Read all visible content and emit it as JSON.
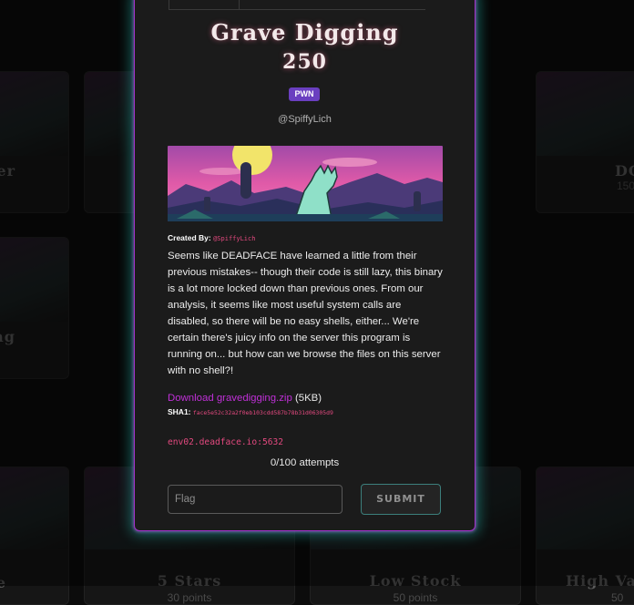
{
  "challenge": {
    "title": "Grave Digging",
    "points": "250",
    "category": "PWN",
    "handle": "@SpiffyLich",
    "created_by_label": "Created By:",
    "created_by_author": "@SpiffyLich",
    "description": "Seems like DEADFACE have learned a little from their previous mistakes-- though their code is still lazy, this binary is a lot more locked down than previous ones. From our analysis, it seems like most useful system calls are disabled, so there will be no easy shells, either... We're certain there's juicy info on the server this program is running on... but how can we browse the files on this server with no shell?!",
    "download_link": "Download gravedigging.zip",
    "download_size": "(5KB)",
    "sha_label": "SHA1:",
    "sha_value": "face5e52c32a2f0eb103cdd587b78b31d06305d9",
    "connection": "env02.deadface.io:5632",
    "attempts": "0/100 attempts"
  },
  "form": {
    "flag_placeholder": "Flag",
    "submit_label": "SUBMIT"
  },
  "background_cards": [
    {
      "title": "er",
      "points": ""
    },
    {
      "title": "DC",
      "points": "150"
    },
    {
      "title": "ng",
      "points": ""
    },
    {
      "title": "e",
      "points": ""
    },
    {
      "title": "5 Stars",
      "points": "30 points"
    },
    {
      "title": "Low Stock",
      "points": "50 points"
    },
    {
      "title": "High Val",
      "points": "50"
    }
  ],
  "colors": {
    "accent_purple": "#a230c8",
    "glow_teal": "#28c8be",
    "code_pink": "#e3497f",
    "badge_purple": "#6a3fc0"
  }
}
